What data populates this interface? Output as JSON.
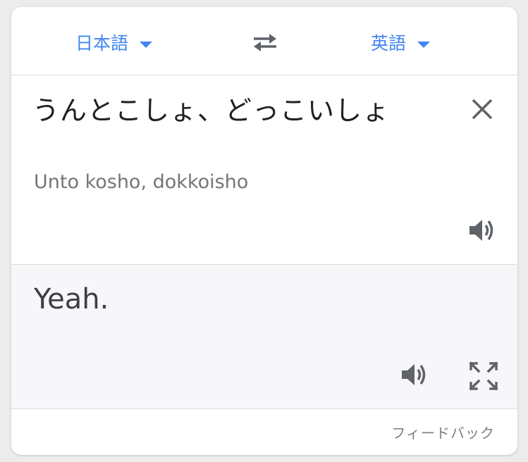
{
  "languages": {
    "source_label": "日本語",
    "target_label": "英語",
    "accent_color": "#4285f4"
  },
  "source": {
    "text": "うんとこしょ、どっこいしょ",
    "romanization": "Unto kosho, dokkoisho"
  },
  "translation": {
    "text": "Yeah."
  },
  "footer": {
    "feedback_label": "フィードバック"
  },
  "icons": {
    "swap": "swap-languages-icon",
    "clear": "close-icon",
    "speak": "speaker-icon",
    "fullscreen": "fullscreen-icon"
  }
}
